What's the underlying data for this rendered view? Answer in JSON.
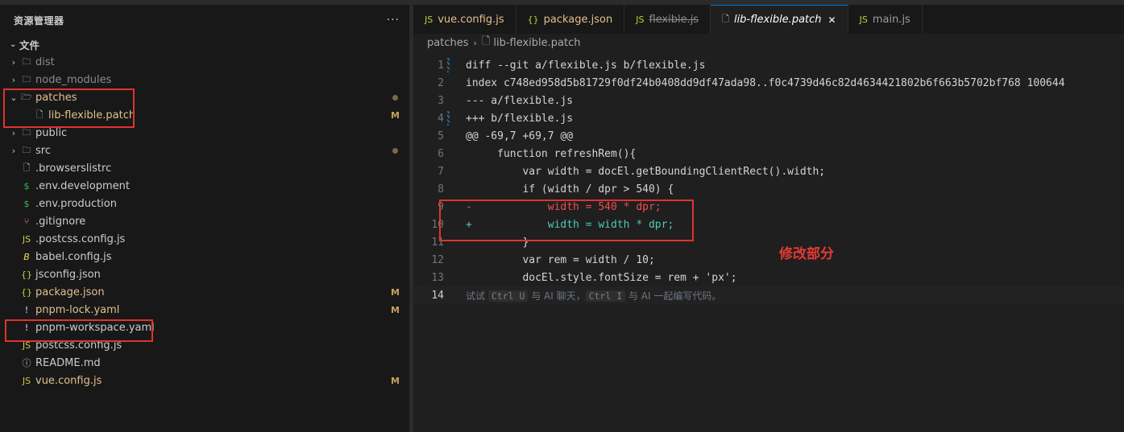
{
  "explorer": {
    "title": "资源管理器",
    "more": "···",
    "root_label": "文件",
    "items": [
      {
        "label": "dist",
        "type": "folder",
        "chev": "›",
        "muted": true
      },
      {
        "label": "node_modules",
        "type": "folder",
        "chev": "›",
        "muted": true
      },
      {
        "label": "patches",
        "type": "folder-open",
        "chev": "⌄",
        "modified": true,
        "dot": true
      },
      {
        "label": "lib-flexible.patch",
        "type": "file",
        "modified": true,
        "badge": "M",
        "indent": true
      },
      {
        "label": "public",
        "type": "folder",
        "chev": "›"
      },
      {
        "label": "src",
        "type": "folder",
        "chev": "›",
        "dot": true
      },
      {
        "label": ".browserslistrc",
        "type": "file"
      },
      {
        "label": ".env.development",
        "type": "env"
      },
      {
        "label": ".env.production",
        "type": "env"
      },
      {
        "label": ".gitignore",
        "type": "git"
      },
      {
        "label": ".postcss.config.js",
        "type": "js"
      },
      {
        "label": "babel.config.js",
        "type": "babel"
      },
      {
        "label": "jsconfig.json",
        "type": "json"
      },
      {
        "label": "package.json",
        "type": "json",
        "modified": true,
        "badge": "M"
      },
      {
        "label": "pnpm-lock.yaml",
        "type": "yaml",
        "modified": true,
        "badge": "M"
      },
      {
        "label": "pnpm-workspace.yaml",
        "type": "yaml"
      },
      {
        "label": "postcss.config.js",
        "type": "js"
      },
      {
        "label": "README.md",
        "type": "info"
      },
      {
        "label": "vue.config.js",
        "type": "js",
        "modified": true,
        "badge": "M"
      }
    ]
  },
  "tabs": [
    {
      "icon": "JS",
      "label": "vue.config.js",
      "style": "modified"
    },
    {
      "icon": "{}",
      "label": "package.json",
      "style": "modified"
    },
    {
      "icon": "JS",
      "label": "flexible.js",
      "style": "deleted"
    },
    {
      "icon": "file",
      "label": "lib-flexible.patch",
      "style": "active",
      "close": "✕"
    },
    {
      "icon": "JS",
      "label": "main.js",
      "style": "normal"
    }
  ],
  "breadcrumb": {
    "folder": "patches",
    "file": "lib-flexible.patch"
  },
  "code_lines": [
    {
      "n": "1",
      "text": "diff --git a/flexible.js b/flexible.js",
      "mark": true
    },
    {
      "n": "2",
      "text": "index c748ed958d5b81729f0df24b0408dd9df47ada98..f0c4739d46c82d4634421802b6f663b5702bf768 100644"
    },
    {
      "n": "3",
      "text": "--- a/flexible.js"
    },
    {
      "n": "4",
      "text": "+++ b/flexible.js",
      "mark": true
    },
    {
      "n": "5",
      "text": "@@ -69,7 +69,7 @@"
    },
    {
      "n": "6",
      "text": "     function refreshRem(){"
    },
    {
      "n": "7",
      "text": "         var width = docEl.getBoundingClientRect().width;"
    },
    {
      "n": "8",
      "text": "         if (width / dpr > 540) {"
    },
    {
      "n": "9",
      "text": "-            width = 540 * dpr;",
      "kind": "del"
    },
    {
      "n": "10",
      "text": "+            width = width * dpr;",
      "kind": "add"
    },
    {
      "n": "11",
      "text": "         }"
    },
    {
      "n": "12",
      "text": "         var rem = width / 10;"
    },
    {
      "n": "13",
      "text": "         docEl.style.fontSize = rem + 'px';"
    }
  ],
  "current_line": {
    "n": "14",
    "hint_parts": [
      "试试 ",
      "Ctrl U",
      " 与 AI 聊天，",
      "Ctrl I",
      " 与 AI 一起编写代码。"
    ]
  },
  "annotation": "修改部分",
  "colors": {
    "accent": "#0078d4",
    "modified": "#e2c08d",
    "redbox": "#e0332f",
    "del": "#f14c4c",
    "add": "#4ec9b0"
  }
}
